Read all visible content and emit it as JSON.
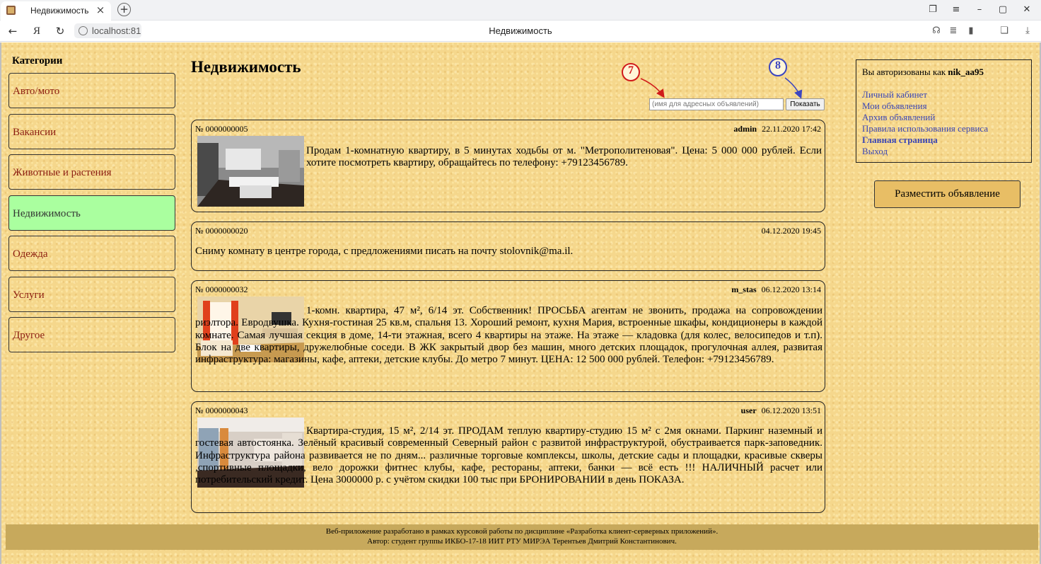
{
  "browser": {
    "tab_title": "Недвижимость",
    "url": "localhost:81",
    "page_caption": "Недвижимость"
  },
  "categories": {
    "heading": "Категории",
    "items": [
      {
        "label": "Авто/мото"
      },
      {
        "label": "Вакансии"
      },
      {
        "label": "Животные и растения"
      },
      {
        "label": "Недвижимость",
        "active": true
      },
      {
        "label": "Одежда"
      },
      {
        "label": "Услуги"
      },
      {
        "label": "Другое"
      }
    ]
  },
  "main": {
    "title": "Недвижимость",
    "search": {
      "placeholder": "(имя для адресных объявлений)",
      "value": ""
    },
    "show_button": "Показать",
    "markers": [
      "7",
      "8"
    ]
  },
  "ads": [
    {
      "number": "№ 0000000005",
      "author": "admin",
      "date": "22.11.2020 17:42",
      "has_photo": true,
      "photo_icon": "living-room-photo",
      "text": "Продам 1-комнатную квартиру, в 5 минутах ходьбы от м. \"Метрополитеновая\". Цена: 5 000 000 рублей. Если хотите посмотреть квартиру, обращайтесь по телефону: +79123456789."
    },
    {
      "number": "№ 0000000020",
      "author": "",
      "date": "04.12.2020 19:45",
      "has_photo": false,
      "text": "Сниму комнату в центре города, с предложениями писать на почту stolovnik@ma.il."
    },
    {
      "number": "№ 0000000032",
      "author": "m_stas",
      "date": "06.12.2020 13:14",
      "has_photo": true,
      "photo_icon": "living-room-photo",
      "text": "1-комн. квартира, 47 м², 6/14 эт. Собственник! ПРОСЬБА агентам не звонить, продажа на сопровождении риэлтора. Евродвушка. Кухня-гостиная 25 кв.м, спальня 13. Хороший ремонт, кухня Мария, встроенные шкафы, кондиционеры в каждой комнате. Самая лучшая секция в доме, 14-ти этажная, всего 4 квартиры на этаже. На этаже — кладовка (для колес, велосипедов и т.п). Блок на две квартиры, дружелюбные соседи. В ЖК закрытый двор без машин, много детских площадок, прогулочная аллея, развитая инфраструктура: магазины, кафе, аптеки, детские клубы. До метро 7 минут. ЦЕНА: 12 500 000 рублей. Телефон: +79123456789."
    },
    {
      "number": "№ 0000000043",
      "author": "user",
      "date": "06.12.2020 13:51",
      "has_photo": true,
      "photo_icon": "empty-room-photo",
      "text": "Квартира-студия, 15 м², 2/14 эт. ПРОДАМ теплую квартиру-студию 15 м² с 2мя окнами. Паркинг наземный и гостевая автостоянка. Зелёный красивый современный Северный район с развитой инфраструктурой, обустраивается парк-заповедник. Инфраструктура района развивается не по дням... различные торговые комплексы, школы, детские сады и площадки, красивые скверы ,спортивные площадки, вело дорожки фитнес клубы, кафе, рестораны, аптеки, банки — всё есть !!! НАЛИЧНЫЙ расчет или потребительский кредит. Цена 3000000 р. с учётом скидки 100 тыс при БРОНИРОВАНИИ в день ПОКАЗА."
    }
  ],
  "account": {
    "auth_prefix": "Вы авторизованы как ",
    "username": "nik_aa95",
    "links": [
      {
        "label": "Личный кабинет"
      },
      {
        "label": "Мои объявления"
      },
      {
        "label": "Архив объявлений"
      },
      {
        "label": "Правила использования сервиса"
      },
      {
        "label": "Главная страница",
        "bold": true
      },
      {
        "label": "Выход"
      }
    ],
    "post_button": "Разместить объявление"
  },
  "footer": {
    "line1": "Веб-приложение разработано в рамках курсовой работы по дисциплине «Разработка клиент-серверных приложений».",
    "line2": "Автор: студент группы ИКБО-17-18 ИИТ РТУ МИРЭА Терентьев Дмитрий Константинович."
  },
  "colors": {
    "background": "#f5d78c",
    "active_category": "#aaff9f",
    "category_text": "#8b1c10",
    "link": "#3b46b4",
    "post_button": "#e8be65",
    "footer": "#c7a95c"
  }
}
